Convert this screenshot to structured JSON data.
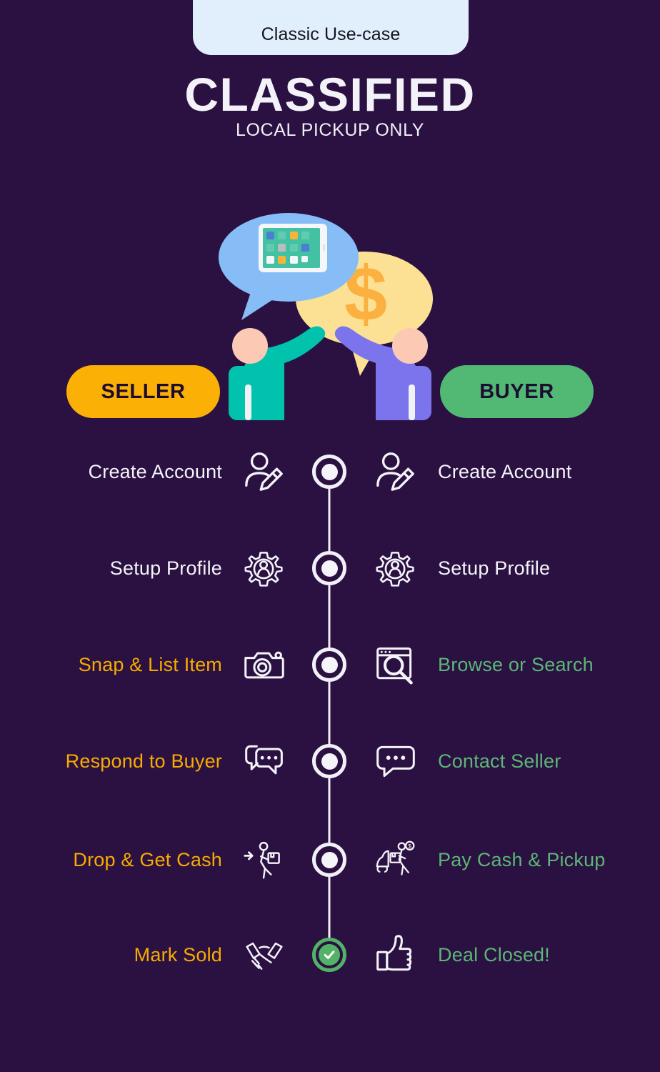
{
  "header": {
    "pill_label": "Classic Use-case",
    "title": "CLASSIFIED",
    "subtitle": "LOCAL PICKUP ONLY"
  },
  "roles": {
    "seller_label": "SELLER",
    "buyer_label": "BUYER",
    "seller_color": "#fbb005",
    "buyer_color": "#52b975"
  },
  "colors": {
    "background": "#2a1142",
    "pill_background": "#e1effc",
    "white_text": "#f4f3f8",
    "amber_text": "#f8ab00",
    "green_text": "#5cb675",
    "timeline_line": "#f2f0f7",
    "final_node": "#52b268",
    "seller_figure": "#00c2ad",
    "buyer_figure": "#7b74ec",
    "bubble_blue": "#87bdf6",
    "bubble_yellow": "#fce194",
    "dollar_sign": "#fbb040",
    "skin": "#fcc9b4"
  },
  "illustration": {
    "bubble_blue_icon": "tablet-icon",
    "bubble_yellow_icon": "dollar-sign-icon",
    "left_figure": "seller-figure",
    "right_figure": "buyer-figure"
  },
  "timeline": {
    "steps": [
      {
        "seller_label": "Create Account",
        "seller_icon": "person-add-pencil-icon",
        "seller_color": "white",
        "buyer_label": "Create Account",
        "buyer_icon": "person-add-pencil-icon",
        "buyer_color": "white",
        "node": "dot"
      },
      {
        "seller_label": "Setup Profile",
        "seller_icon": "gear-person-icon",
        "seller_color": "white",
        "buyer_label": "Setup Profile",
        "buyer_icon": "gear-person-icon",
        "buyer_color": "white",
        "node": "dot"
      },
      {
        "seller_label": "Snap & List Item",
        "seller_icon": "camera-icon",
        "seller_color": "amber",
        "buyer_label": "Browse or Search",
        "buyer_icon": "browser-search-icon",
        "buyer_color": "green",
        "node": "dot"
      },
      {
        "seller_label": "Respond to Buyer",
        "seller_icon": "chat-bubbles-icon",
        "seller_color": "amber",
        "buyer_label": "Contact Seller",
        "buyer_icon": "chat-bubble-icon",
        "buyer_color": "green",
        "node": "dot"
      },
      {
        "seller_label": "Drop & Get Cash",
        "seller_icon": "delivery-person-box-icon",
        "seller_color": "amber",
        "buyer_label": "Pay Cash & Pickup",
        "buyer_icon": "car-pickup-cash-icon",
        "buyer_color": "green",
        "node": "dot"
      },
      {
        "seller_label": "Mark Sold",
        "seller_icon": "handshake-icon",
        "seller_color": "amber",
        "buyer_label": "Deal Closed!",
        "buyer_icon": "thumbs-up-icon",
        "buyer_color": "green",
        "node": "check"
      }
    ]
  }
}
